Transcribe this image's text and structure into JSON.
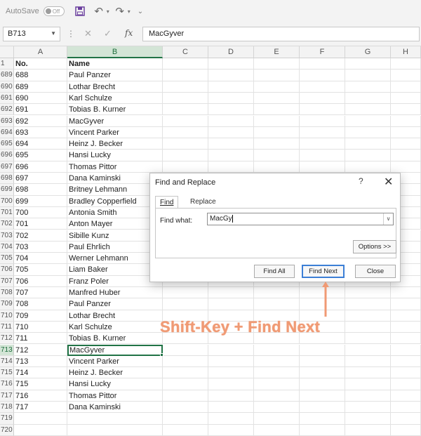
{
  "toolbar": {
    "autosave_label": "AutoSave",
    "autosave_state": "Off"
  },
  "formula_bar": {
    "name_box": "B713",
    "formula": "MacGyver"
  },
  "columns": [
    "A",
    "B",
    "C",
    "D",
    "E",
    "F",
    "G",
    "H"
  ],
  "rows": [
    {
      "num": "1",
      "a": "No.",
      "b": "Name",
      "header": true
    },
    {
      "num": "689",
      "a": "688",
      "b": "Paul Panzer"
    },
    {
      "num": "690",
      "a": "689",
      "b": "Lothar Brecht"
    },
    {
      "num": "691",
      "a": "690",
      "b": "Karl Schulze"
    },
    {
      "num": "692",
      "a": "691",
      "b": "Tobias B. Kurner"
    },
    {
      "num": "693",
      "a": "692",
      "b": "MacGyver"
    },
    {
      "num": "694",
      "a": "693",
      "b": "Vincent Parker"
    },
    {
      "num": "695",
      "a": "694",
      "b": "Heinz J. Becker"
    },
    {
      "num": "696",
      "a": "695",
      "b": "Hansi Lucky"
    },
    {
      "num": "697",
      "a": "696",
      "b": "Thomas Pittor"
    },
    {
      "num": "698",
      "a": "697",
      "b": "Dana Kaminski"
    },
    {
      "num": "699",
      "a": "698",
      "b": "Britney Lehmann"
    },
    {
      "num": "700",
      "a": "699",
      "b": "Bradley Copperfield"
    },
    {
      "num": "701",
      "a": "700",
      "b": "Antonia Smith"
    },
    {
      "num": "702",
      "a": "701",
      "b": "Anton Mayer"
    },
    {
      "num": "703",
      "a": "702",
      "b": "Sibille Kunz"
    },
    {
      "num": "704",
      "a": "703",
      "b": "Paul Ehrlich"
    },
    {
      "num": "705",
      "a": "704",
      "b": "Werner Lehmann"
    },
    {
      "num": "706",
      "a": "705",
      "b": "Liam Baker"
    },
    {
      "num": "707",
      "a": "706",
      "b": "Franz Poler"
    },
    {
      "num": "708",
      "a": "707",
      "b": "Manfred Huber"
    },
    {
      "num": "709",
      "a": "708",
      "b": "Paul Panzer"
    },
    {
      "num": "710",
      "a": "709",
      "b": "Lothar Brecht"
    },
    {
      "num": "711",
      "a": "710",
      "b": "Karl Schulze"
    },
    {
      "num": "712",
      "a": "711",
      "b": "Tobias B. Kurner"
    },
    {
      "num": "713",
      "a": "712",
      "b": "MacGyver",
      "active": true
    },
    {
      "num": "714",
      "a": "713",
      "b": "Vincent Parker"
    },
    {
      "num": "715",
      "a": "714",
      "b": "Heinz J. Becker"
    },
    {
      "num": "716",
      "a": "715",
      "b": "Hansi Lucky"
    },
    {
      "num": "717",
      "a": "716",
      "b": "Thomas Pittor"
    },
    {
      "num": "718",
      "a": "717",
      "b": "Dana Kaminski"
    },
    {
      "num": "719",
      "a": "",
      "b": ""
    },
    {
      "num": "720",
      "a": "",
      "b": ""
    }
  ],
  "dialog": {
    "title": "Find and Replace",
    "help": "?",
    "close": "✕",
    "tab_find": "Find",
    "tab_replace": "Replace",
    "find_what_label": "Find what:",
    "find_what_value": "MacGy",
    "options_button": "Options >>",
    "find_all_button": "Find All",
    "find_next_button": "Find Next",
    "close_button": "Close"
  },
  "annotation": {
    "text": "Shift-Key + Find Next",
    "color": "#f09a74"
  },
  "colors": {
    "excel_green": "#217346",
    "selection_header": "#d3e5d6",
    "dialog_focus": "#3c7fd6"
  }
}
